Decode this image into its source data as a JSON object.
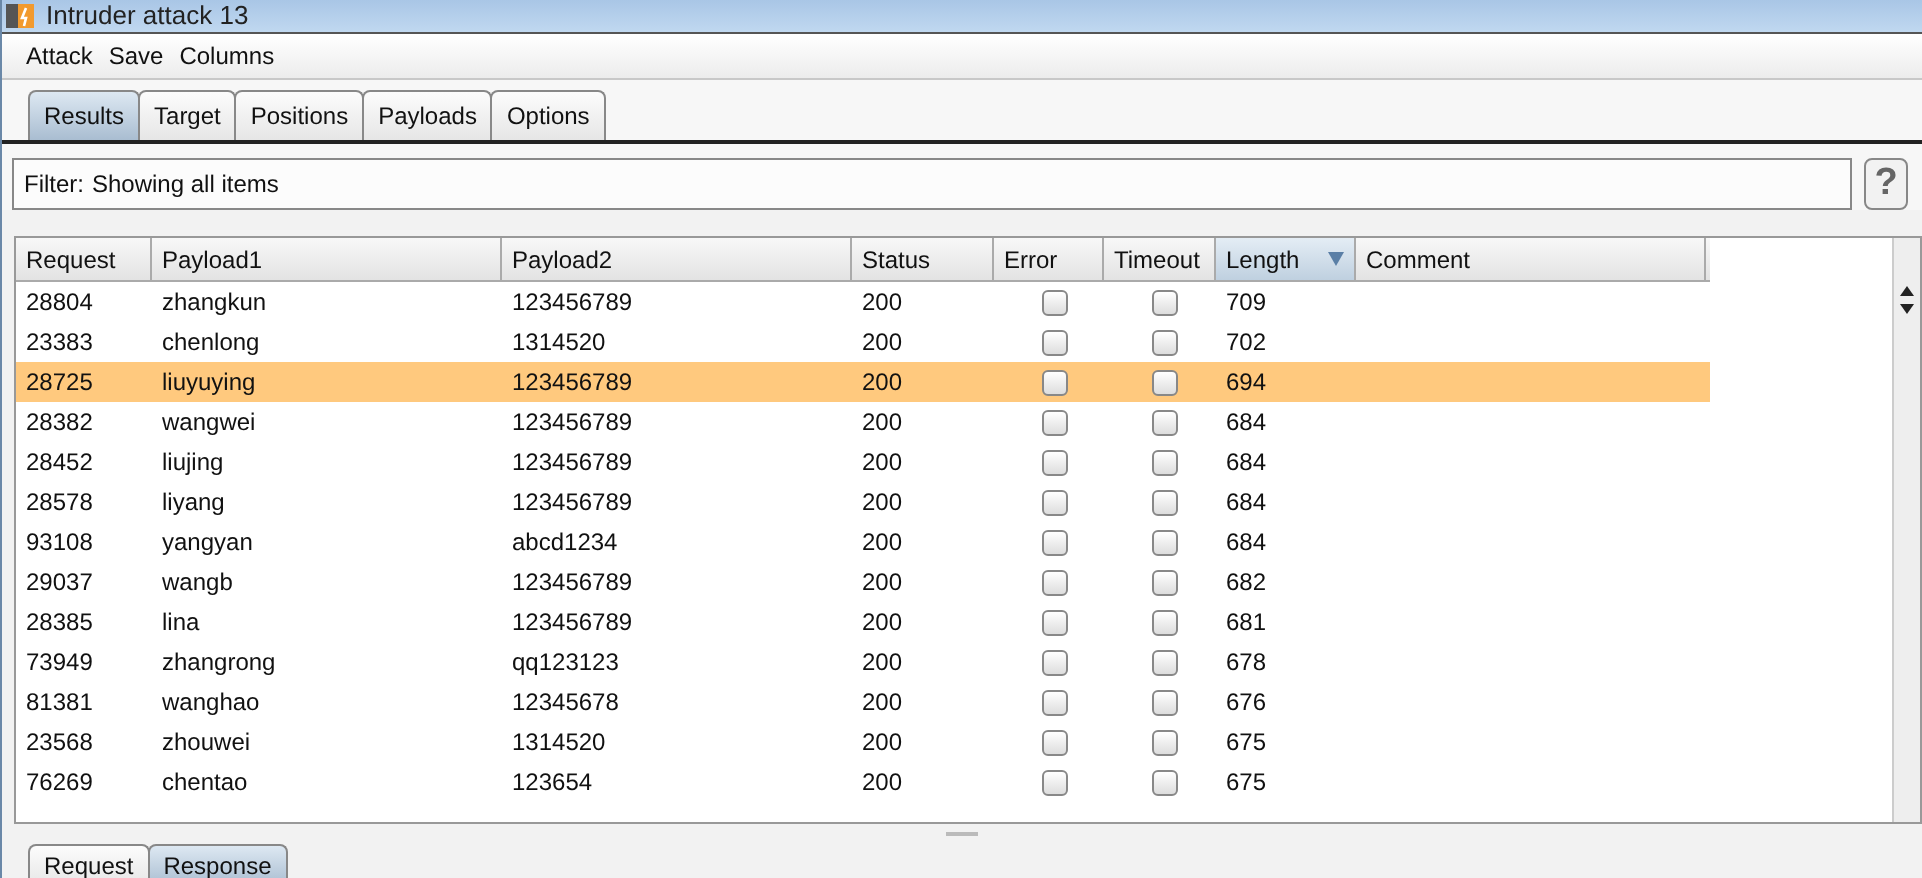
{
  "window": {
    "title": "Intruder attack 13"
  },
  "menu": [
    "Attack",
    "Save",
    "Columns"
  ],
  "tabs": [
    {
      "label": "Results",
      "selected": true
    },
    {
      "label": "Target",
      "selected": false
    },
    {
      "label": "Positions",
      "selected": false
    },
    {
      "label": "Payloads",
      "selected": false
    },
    {
      "label": "Options",
      "selected": false
    }
  ],
  "filter": {
    "label": "Filter:",
    "value": "Showing all items",
    "help": "?"
  },
  "table": {
    "columns": [
      {
        "label": "Request",
        "sorted": false
      },
      {
        "label": "Payload1",
        "sorted": false
      },
      {
        "label": "Payload2",
        "sorted": false
      },
      {
        "label": "Status",
        "sorted": false
      },
      {
        "label": "Error",
        "sorted": false
      },
      {
        "label": "Timeout",
        "sorted": false
      },
      {
        "label": "Length",
        "sorted": true
      },
      {
        "label": "Comment",
        "sorted": false
      }
    ],
    "rows": [
      {
        "request": "28804",
        "payload1": "zhangkun",
        "payload2": "123456789",
        "status": "200",
        "error": false,
        "timeout": false,
        "length": "709",
        "selected": false
      },
      {
        "request": "23383",
        "payload1": "chenlong",
        "payload2": "1314520",
        "status": "200",
        "error": false,
        "timeout": false,
        "length": "702",
        "selected": false
      },
      {
        "request": "28725",
        "payload1": "liuyuying",
        "payload2": "123456789",
        "status": "200",
        "error": false,
        "timeout": false,
        "length": "694",
        "selected": true
      },
      {
        "request": "28382",
        "payload1": "wangwei",
        "payload2": "123456789",
        "status": "200",
        "error": false,
        "timeout": false,
        "length": "684",
        "selected": false
      },
      {
        "request": "28452",
        "payload1": "liujing",
        "payload2": "123456789",
        "status": "200",
        "error": false,
        "timeout": false,
        "length": "684",
        "selected": false
      },
      {
        "request": "28578",
        "payload1": "liyang",
        "payload2": "123456789",
        "status": "200",
        "error": false,
        "timeout": false,
        "length": "684",
        "selected": false
      },
      {
        "request": "93108",
        "payload1": "yangyan",
        "payload2": "abcd1234",
        "status": "200",
        "error": false,
        "timeout": false,
        "length": "684",
        "selected": false
      },
      {
        "request": "29037",
        "payload1": "wangb",
        "payload2": "123456789",
        "status": "200",
        "error": false,
        "timeout": false,
        "length": "682",
        "selected": false
      },
      {
        "request": "28385",
        "payload1": "lina",
        "payload2": "123456789",
        "status": "200",
        "error": false,
        "timeout": false,
        "length": "681",
        "selected": false
      },
      {
        "request": "73949",
        "payload1": "zhangrong",
        "payload2": "qq123123",
        "status": "200",
        "error": false,
        "timeout": false,
        "length": "678",
        "selected": false
      },
      {
        "request": "81381",
        "payload1": "wanghao",
        "payload2": "12345678",
        "status": "200",
        "error": false,
        "timeout": false,
        "length": "676",
        "selected": false
      },
      {
        "request": "23568",
        "payload1": "zhouwei",
        "payload2": "1314520",
        "status": "200",
        "error": false,
        "timeout": false,
        "length": "675",
        "selected": false
      },
      {
        "request": "76269",
        "payload1": "chentao",
        "payload2": "123654",
        "status": "200",
        "error": false,
        "timeout": false,
        "length": "675",
        "selected": false
      }
    ]
  },
  "bottom_tabs": [
    {
      "label": "Request",
      "selected": false
    },
    {
      "label": "Response",
      "selected": true
    }
  ]
}
